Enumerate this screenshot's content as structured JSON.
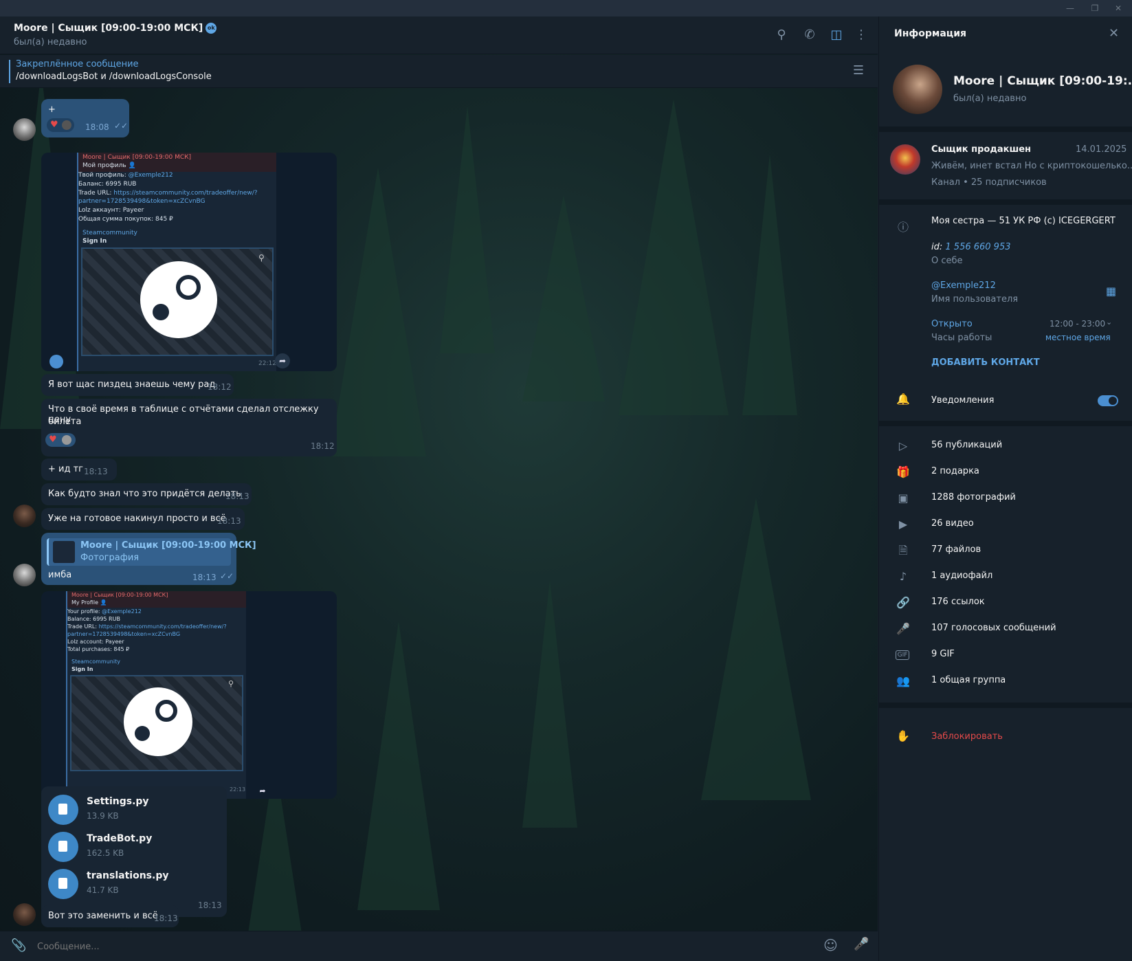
{
  "window": {
    "min": "—",
    "restore": "❐",
    "close": "✕"
  },
  "header": {
    "title": "Moore | Сыщик [09:00-19:00 МСК]",
    "badge": "ok",
    "status": "был(а) недавно"
  },
  "pinned": {
    "title": "Закреплённое сообщение",
    "text": "/downloadLogsBot и /downloadLogsConsole"
  },
  "messages": {
    "m1": {
      "text": "+",
      "time": "18:08"
    },
    "shot1": {
      "from": "Moore | Сыщик [09:00-19:00 МСК]",
      "l1": "Мой профиль 👤",
      "l2a": "Твой профиль: ",
      "l2b": "@Exemple212",
      "l3": "Баланс: 6995 RUB",
      "l4a": "Trade URL: ",
      "l4b": "https://steamcommunity.com/tradeoffer/new/?",
      "l5": "partner=1728539498&token=xcZCvnBG",
      "l6": "Lolz аккаунт: Payeer",
      "l7": "Общая сумма покупок: 845 ₽",
      "site": "Steamcommunity",
      "signin": "Sign In",
      "time": "22:12"
    },
    "m2": {
      "text": "Я вот щас пиздец знаешь чему рад",
      "time": "18:12"
    },
    "m3": {
      "text1": "Что в своё время в таблице с отчётами сделал отслежку цену",
      "text2": "билета",
      "time": "18:12"
    },
    "m4": {
      "text": "+ ид тг",
      "time": "18:13"
    },
    "m5": {
      "text": "Как будто знал что это придётся делать",
      "time": "18:13"
    },
    "m6": {
      "text": "Уже на готовое накинул просто и всё",
      "time": "18:13"
    },
    "m7": {
      "reply_name": "Moore | Сыщик [09:00-19:00 МСК]",
      "reply_text": "Фотография",
      "text": "имба",
      "time": "18:13"
    },
    "shot2": {
      "from": "Moore | Сыщик [09:00-19:00 МСК]",
      "l1": "My Profile 👤",
      "l2a": "Your profile: ",
      "l2b": "@Exemple212",
      "l3": "Balance: 6995 RUB",
      "l4a": "Trade URL: ",
      "l4b": "https://steamcommunity.com/tradeoffer/new/?",
      "l5": "partner=1728539498&token=xcZCvnBG",
      "l6": "Lolz account: Payeer",
      "l7": "Total purchases: 845 ₽",
      "site": "Steamcommunity",
      "signin": "Sign In",
      "time": "22:13"
    },
    "files": [
      {
        "name": "Settings.py",
        "size": "13.9 KB"
      },
      {
        "name": "TradeBot.py",
        "size": "162.5 KB"
      },
      {
        "name": "translations.py",
        "size": "41.7 KB"
      }
    ],
    "files_time": "18:13",
    "m8": {
      "text": "Вот это заменить и всё",
      "time": "18:13"
    }
  },
  "composer": {
    "placeholder": "Сообщение..."
  },
  "info": {
    "title": "Информация",
    "name": "Moore | Сыщик [09:00-19:...",
    "status": "был(а) недавно",
    "channel": {
      "name": "Сыщик продакшен",
      "date": "14.01.2025",
      "text": "Живём, инет встал  Но с криптокошелько...",
      "sub": "Канал • 25 подписчиков"
    },
    "bio": "Моя сестра — 51 УК РФ (c) ICEGERGERT",
    "id_label": "id: ",
    "id_value": "1 556 660 953",
    "about": "О себе",
    "username": "@Exemple212",
    "username_label": "Имя пользователя",
    "open": "Открыто",
    "hours": "12:00 - 23:00",
    "hours_label": "Часы работы",
    "local_time": "местное время",
    "add_contact": "ДОБАВИТЬ КОНТАКТ",
    "notifications": "Уведомления",
    "stats": [
      {
        "icon": "stories-icon",
        "label": "56 публикаций"
      },
      {
        "icon": "gift-icon",
        "label": "2 подарка"
      },
      {
        "icon": "photo-icon",
        "label": "1288 фотографий"
      },
      {
        "icon": "video-icon",
        "label": "26 видео"
      },
      {
        "icon": "file-icon",
        "label": "77 файлов"
      },
      {
        "icon": "headphones-icon",
        "label": "1 аудиофайл"
      },
      {
        "icon": "link-icon",
        "label": "176 ссылок"
      },
      {
        "icon": "mic-icon",
        "label": "107 голосовых сообщений"
      },
      {
        "icon": "gif-icon",
        "label": "9 GIF"
      },
      {
        "icon": "group-icon",
        "label": "1 общая группа"
      }
    ],
    "block": "Заблокировать"
  },
  "colors": {
    "accent": "#5fa7e6",
    "danger": "#e64a4a",
    "bg": "#17212b",
    "out_bubble": "#2b5278",
    "in_bubble": "#182533"
  }
}
